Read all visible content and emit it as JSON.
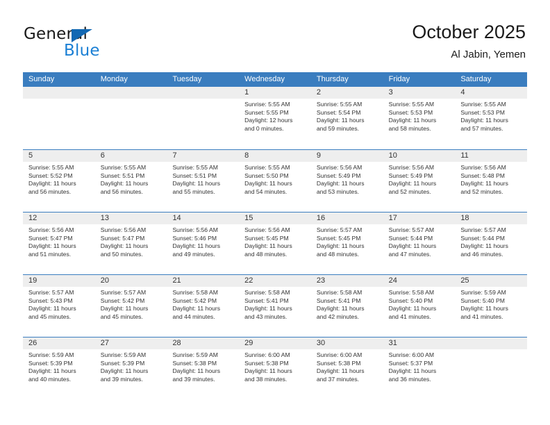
{
  "logo": {
    "text_top": "General",
    "text_bottom": "Blue",
    "triangle_icon": "triangle-icon",
    "blue": "#1268b3",
    "light_blue": "#1a7fd4"
  },
  "header": {
    "title": "October 2025",
    "subtitle": "Al Jabin, Yemen"
  },
  "colors": {
    "header_blue": "#3a7dbf",
    "daynumber_gray": "#eeeeee",
    "text": "#333333"
  },
  "weekday_headers": [
    "Sunday",
    "Monday",
    "Tuesday",
    "Wednesday",
    "Thursday",
    "Friday",
    "Saturday"
  ],
  "weeks": [
    [
      {
        "day": "",
        "sunrise": "",
        "sunset": "",
        "daylight_line1": "",
        "daylight_line2": ""
      },
      {
        "day": "",
        "sunrise": "",
        "sunset": "",
        "daylight_line1": "",
        "daylight_line2": ""
      },
      {
        "day": "",
        "sunrise": "",
        "sunset": "",
        "daylight_line1": "",
        "daylight_line2": ""
      },
      {
        "day": "1",
        "sunrise": "Sunrise: 5:55 AM",
        "sunset": "Sunset: 5:55 PM",
        "daylight_line1": "Daylight: 12 hours",
        "daylight_line2": "and 0 minutes."
      },
      {
        "day": "2",
        "sunrise": "Sunrise: 5:55 AM",
        "sunset": "Sunset: 5:54 PM",
        "daylight_line1": "Daylight: 11 hours",
        "daylight_line2": "and 59 minutes."
      },
      {
        "day": "3",
        "sunrise": "Sunrise: 5:55 AM",
        "sunset": "Sunset: 5:53 PM",
        "daylight_line1": "Daylight: 11 hours",
        "daylight_line2": "and 58 minutes."
      },
      {
        "day": "4",
        "sunrise": "Sunrise: 5:55 AM",
        "sunset": "Sunset: 5:53 PM",
        "daylight_line1": "Daylight: 11 hours",
        "daylight_line2": "and 57 minutes."
      }
    ],
    [
      {
        "day": "5",
        "sunrise": "Sunrise: 5:55 AM",
        "sunset": "Sunset: 5:52 PM",
        "daylight_line1": "Daylight: 11 hours",
        "daylight_line2": "and 56 minutes."
      },
      {
        "day": "6",
        "sunrise": "Sunrise: 5:55 AM",
        "sunset": "Sunset: 5:51 PM",
        "daylight_line1": "Daylight: 11 hours",
        "daylight_line2": "and 56 minutes."
      },
      {
        "day": "7",
        "sunrise": "Sunrise: 5:55 AM",
        "sunset": "Sunset: 5:51 PM",
        "daylight_line1": "Daylight: 11 hours",
        "daylight_line2": "and 55 minutes."
      },
      {
        "day": "8",
        "sunrise": "Sunrise: 5:55 AM",
        "sunset": "Sunset: 5:50 PM",
        "daylight_line1": "Daylight: 11 hours",
        "daylight_line2": "and 54 minutes."
      },
      {
        "day": "9",
        "sunrise": "Sunrise: 5:56 AM",
        "sunset": "Sunset: 5:49 PM",
        "daylight_line1": "Daylight: 11 hours",
        "daylight_line2": "and 53 minutes."
      },
      {
        "day": "10",
        "sunrise": "Sunrise: 5:56 AM",
        "sunset": "Sunset: 5:49 PM",
        "daylight_line1": "Daylight: 11 hours",
        "daylight_line2": "and 52 minutes."
      },
      {
        "day": "11",
        "sunrise": "Sunrise: 5:56 AM",
        "sunset": "Sunset: 5:48 PM",
        "daylight_line1": "Daylight: 11 hours",
        "daylight_line2": "and 52 minutes."
      }
    ],
    [
      {
        "day": "12",
        "sunrise": "Sunrise: 5:56 AM",
        "sunset": "Sunset: 5:47 PM",
        "daylight_line1": "Daylight: 11 hours",
        "daylight_line2": "and 51 minutes."
      },
      {
        "day": "13",
        "sunrise": "Sunrise: 5:56 AM",
        "sunset": "Sunset: 5:47 PM",
        "daylight_line1": "Daylight: 11 hours",
        "daylight_line2": "and 50 minutes."
      },
      {
        "day": "14",
        "sunrise": "Sunrise: 5:56 AM",
        "sunset": "Sunset: 5:46 PM",
        "daylight_line1": "Daylight: 11 hours",
        "daylight_line2": "and 49 minutes."
      },
      {
        "day": "15",
        "sunrise": "Sunrise: 5:56 AM",
        "sunset": "Sunset: 5:45 PM",
        "daylight_line1": "Daylight: 11 hours",
        "daylight_line2": "and 48 minutes."
      },
      {
        "day": "16",
        "sunrise": "Sunrise: 5:57 AM",
        "sunset": "Sunset: 5:45 PM",
        "daylight_line1": "Daylight: 11 hours",
        "daylight_line2": "and 48 minutes."
      },
      {
        "day": "17",
        "sunrise": "Sunrise: 5:57 AM",
        "sunset": "Sunset: 5:44 PM",
        "daylight_line1": "Daylight: 11 hours",
        "daylight_line2": "and 47 minutes."
      },
      {
        "day": "18",
        "sunrise": "Sunrise: 5:57 AM",
        "sunset": "Sunset: 5:44 PM",
        "daylight_line1": "Daylight: 11 hours",
        "daylight_line2": "and 46 minutes."
      }
    ],
    [
      {
        "day": "19",
        "sunrise": "Sunrise: 5:57 AM",
        "sunset": "Sunset: 5:43 PM",
        "daylight_line1": "Daylight: 11 hours",
        "daylight_line2": "and 45 minutes."
      },
      {
        "day": "20",
        "sunrise": "Sunrise: 5:57 AM",
        "sunset": "Sunset: 5:42 PM",
        "daylight_line1": "Daylight: 11 hours",
        "daylight_line2": "and 45 minutes."
      },
      {
        "day": "21",
        "sunrise": "Sunrise: 5:58 AM",
        "sunset": "Sunset: 5:42 PM",
        "daylight_line1": "Daylight: 11 hours",
        "daylight_line2": "and 44 minutes."
      },
      {
        "day": "22",
        "sunrise": "Sunrise: 5:58 AM",
        "sunset": "Sunset: 5:41 PM",
        "daylight_line1": "Daylight: 11 hours",
        "daylight_line2": "and 43 minutes."
      },
      {
        "day": "23",
        "sunrise": "Sunrise: 5:58 AM",
        "sunset": "Sunset: 5:41 PM",
        "daylight_line1": "Daylight: 11 hours",
        "daylight_line2": "and 42 minutes."
      },
      {
        "day": "24",
        "sunrise": "Sunrise: 5:58 AM",
        "sunset": "Sunset: 5:40 PM",
        "daylight_line1": "Daylight: 11 hours",
        "daylight_line2": "and 41 minutes."
      },
      {
        "day": "25",
        "sunrise": "Sunrise: 5:59 AM",
        "sunset": "Sunset: 5:40 PM",
        "daylight_line1": "Daylight: 11 hours",
        "daylight_line2": "and 41 minutes."
      }
    ],
    [
      {
        "day": "26",
        "sunrise": "Sunrise: 5:59 AM",
        "sunset": "Sunset: 5:39 PM",
        "daylight_line1": "Daylight: 11 hours",
        "daylight_line2": "and 40 minutes."
      },
      {
        "day": "27",
        "sunrise": "Sunrise: 5:59 AM",
        "sunset": "Sunset: 5:39 PM",
        "daylight_line1": "Daylight: 11 hours",
        "daylight_line2": "and 39 minutes."
      },
      {
        "day": "28",
        "sunrise": "Sunrise: 5:59 AM",
        "sunset": "Sunset: 5:38 PM",
        "daylight_line1": "Daylight: 11 hours",
        "daylight_line2": "and 39 minutes."
      },
      {
        "day": "29",
        "sunrise": "Sunrise: 6:00 AM",
        "sunset": "Sunset: 5:38 PM",
        "daylight_line1": "Daylight: 11 hours",
        "daylight_line2": "and 38 minutes."
      },
      {
        "day": "30",
        "sunrise": "Sunrise: 6:00 AM",
        "sunset": "Sunset: 5:38 PM",
        "daylight_line1": "Daylight: 11 hours",
        "daylight_line2": "and 37 minutes."
      },
      {
        "day": "31",
        "sunrise": "Sunrise: 6:00 AM",
        "sunset": "Sunset: 5:37 PM",
        "daylight_line1": "Daylight: 11 hours",
        "daylight_line2": "and 36 minutes."
      },
      {
        "day": "",
        "sunrise": "",
        "sunset": "",
        "daylight_line1": "",
        "daylight_line2": ""
      }
    ]
  ]
}
